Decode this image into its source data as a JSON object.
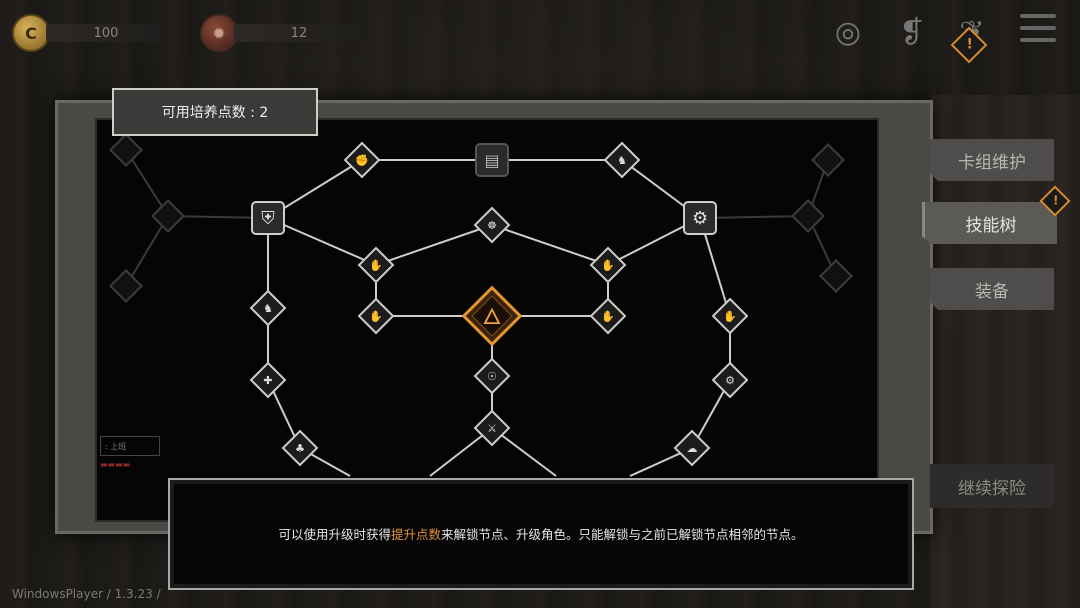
{
  "hud": {
    "coins": "100",
    "gears": "12",
    "coin_icon": "coin-icon",
    "gear_icon": "gear-icon"
  },
  "skill_points": {
    "label": "可用培养点数 : 2"
  },
  "side_tabs": [
    {
      "label": "卡组维护",
      "active": false
    },
    {
      "label": "技能树",
      "active": true
    },
    {
      "label": "装备",
      "active": false
    }
  ],
  "continue_button": "继续探险",
  "dialog": {
    "text_before": "可以使用升级时获得",
    "highlight": "提升点数",
    "text_after": "来解锁节点、升级角色。只能解锁与之前已解锁节点相邻的节点。",
    "highlight_color": "#e8923a"
  },
  "version": "WindowsPlayer / 1.3.23 /",
  "colors": {
    "accent_orange": "#d88a2a",
    "node_fill": "#1c1c1c",
    "line": "#cfcdc8"
  }
}
